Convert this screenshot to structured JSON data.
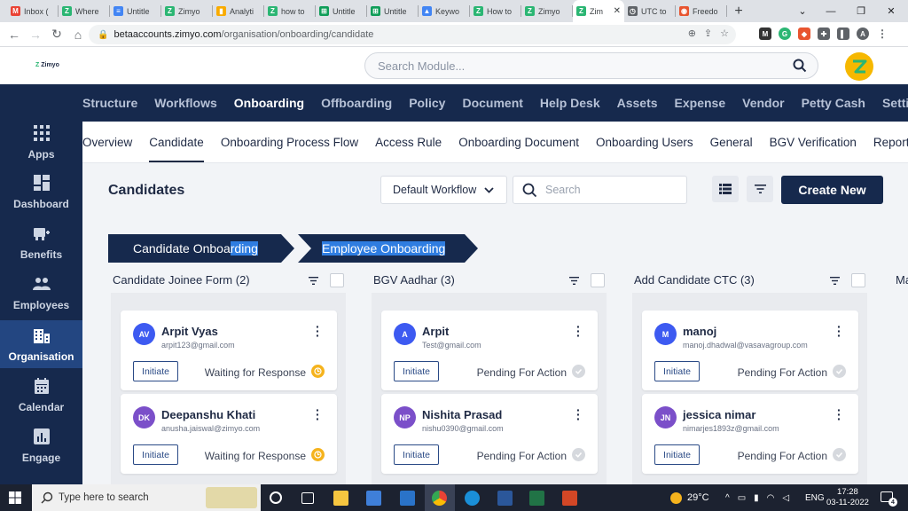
{
  "browser": {
    "tabs": [
      {
        "title": "Inbox (",
        "icon": "gmail-icon",
        "color": "#ea4335"
      },
      {
        "title": "Where",
        "icon": "zimyo-icon",
        "color": "#2bb673"
      },
      {
        "title": "Untitle",
        "icon": "docs-icon",
        "color": "#4285f4"
      },
      {
        "title": "Zimyo",
        "icon": "zimyo-icon",
        "color": "#2bb673"
      },
      {
        "title": "Analyti",
        "icon": "analytics-icon",
        "color": "#f9ab00"
      },
      {
        "title": "how to",
        "icon": "zimyo-icon",
        "color": "#2bb673"
      },
      {
        "title": "Untitle",
        "icon": "sheets-icon",
        "color": "#0f9d58"
      },
      {
        "title": "Untitle",
        "icon": "sheets-icon",
        "color": "#0f9d58"
      },
      {
        "title": "Keywo",
        "icon": "ads-icon",
        "color": "#4285f4"
      },
      {
        "title": "How to",
        "icon": "zimyo-icon",
        "color": "#2bb673"
      },
      {
        "title": "Zimyo",
        "icon": "zimyo-icon",
        "color": "#2bb673"
      },
      {
        "title": "Zim",
        "icon": "zimyo-icon",
        "color": "#2bb673"
      },
      {
        "title": "UTC to",
        "icon": "clock-icon",
        "color": "#5f6368"
      },
      {
        "title": "Freedo",
        "icon": "freedom-icon",
        "color": "#e8542f"
      }
    ],
    "url_host": "betaaccounts.zimyo.com",
    "url_path": "/organisation/onboarding/candidate",
    "profile_initial": "A"
  },
  "app": {
    "logo_text": "Zimyo",
    "search_placeholder": "Search Module..."
  },
  "sidebar": [
    {
      "label": "Apps",
      "icon": "apps-grid-icon"
    },
    {
      "label": "Dashboard",
      "icon": "dashboard-icon"
    },
    {
      "label": "Benefits",
      "icon": "benefits-icon"
    },
    {
      "label": "Employees",
      "icon": "employees-icon"
    },
    {
      "label": "Organisation",
      "icon": "organisation-icon",
      "active": true
    },
    {
      "label": "Calendar",
      "icon": "calendar-icon"
    },
    {
      "label": "Engage",
      "icon": "engage-icon"
    }
  ],
  "module_nav": [
    "Structure",
    "Workflows",
    "Onboarding",
    "Offboarding",
    "Policy",
    "Document",
    "Help Desk",
    "Assets",
    "Expense",
    "Vendor",
    "Petty Cash",
    "Setti"
  ],
  "sub_nav": [
    "Overview",
    "Candidate",
    "Onboarding Process Flow",
    "Access Rule",
    "Onboarding Document",
    "Onboarding Users",
    "General",
    "BGV Verification",
    "Reports"
  ],
  "page": {
    "title": "Candidates",
    "workflow_select": "Default Workflow",
    "search_placeholder": "Search",
    "create_button": "Create New"
  },
  "stages": {
    "stage1_prefix": "Candidate Onboa",
    "stage1_highlight": "rding",
    "stage2": "Employee Onboarding"
  },
  "columns": [
    {
      "title": "Candidate Joinee Form (2)",
      "cards": [
        {
          "initials": "AV",
          "name": "Arpit Vyas",
          "email": "arpit123@gmail.com",
          "button": "Initiate",
          "status": "Waiting for Response",
          "status_type": "waiting",
          "avatar_color": "#3d5af1"
        },
        {
          "initials": "DK",
          "name": "Deepanshu Khati",
          "email": "anusha.jaiswal@zimyo.com",
          "button": "Initiate",
          "status": "Waiting for Response",
          "status_type": "waiting",
          "avatar_color": "#7b4fc9"
        }
      ]
    },
    {
      "title": "BGV Aadhar (3)",
      "cards": [
        {
          "initials": "A",
          "name": "Arpit",
          "email": "Test@gmail.com",
          "button": "Initiate",
          "status": "Pending For Action",
          "status_type": "pending",
          "avatar_color": "#3d5af1"
        },
        {
          "initials": "NP",
          "name": "Nishita Prasad",
          "email": "nishu0390@gmail.com",
          "button": "Initiate",
          "status": "Pending For Action",
          "status_type": "pending",
          "avatar_color": "#7b4fc9"
        }
      ]
    },
    {
      "title": "Add Candidate CTC (3)",
      "cards": [
        {
          "initials": "M",
          "name": "manoj",
          "email": "manoj.dhadwal@vasavagroup.com",
          "button": "Initiate",
          "status": "Pending For Action",
          "status_type": "pending",
          "avatar_color": "#3d5af1"
        },
        {
          "initials": "JN",
          "name": "jessica nimar",
          "email": "nimarjes1893z@gmail.com",
          "button": "Initiate",
          "status": "Pending For Action",
          "status_type": "pending",
          "avatar_color": "#7b4fc9"
        }
      ]
    }
  ],
  "partial_column_title": "Ma",
  "taskbar": {
    "search_placeholder": "Type here to search",
    "temperature": "29°C",
    "language": "ENG",
    "time": "17:28",
    "date": "03-11-2022",
    "notification_count": "4"
  }
}
